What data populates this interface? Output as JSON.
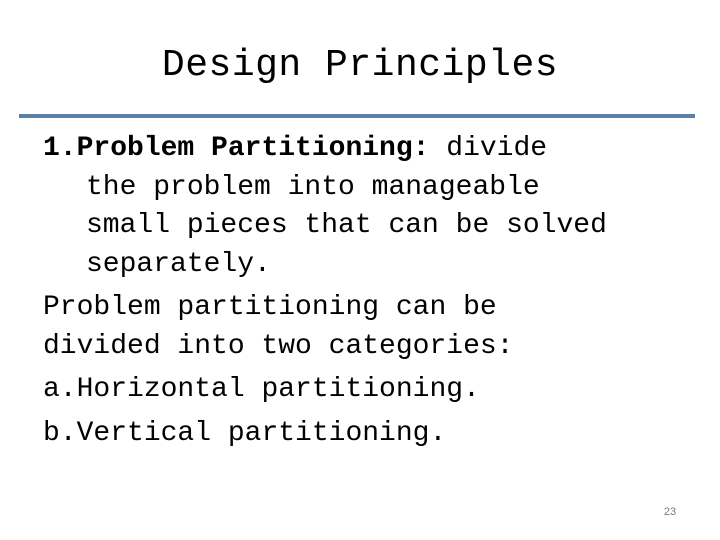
{
  "slide": {
    "title": "Design Principles",
    "accent_color": "#5b80a5",
    "point1": {
      "number": "1.",
      "heading": "Problem Partitioning:",
      "first_line_rest": " divide",
      "continuation_lines": [
        "the problem into manageable",
        "small pieces that can be solved",
        "separately."
      ]
    },
    "paragraph_lines": [
      "Problem partitioning can be",
      "divided into two categories:"
    ],
    "sub_items": [
      {
        "marker": "a.",
        "text": "Horizontal partitioning."
      },
      {
        "marker": "b.",
        "text": "Vertical partitioning."
      }
    ],
    "page_number": "23"
  }
}
